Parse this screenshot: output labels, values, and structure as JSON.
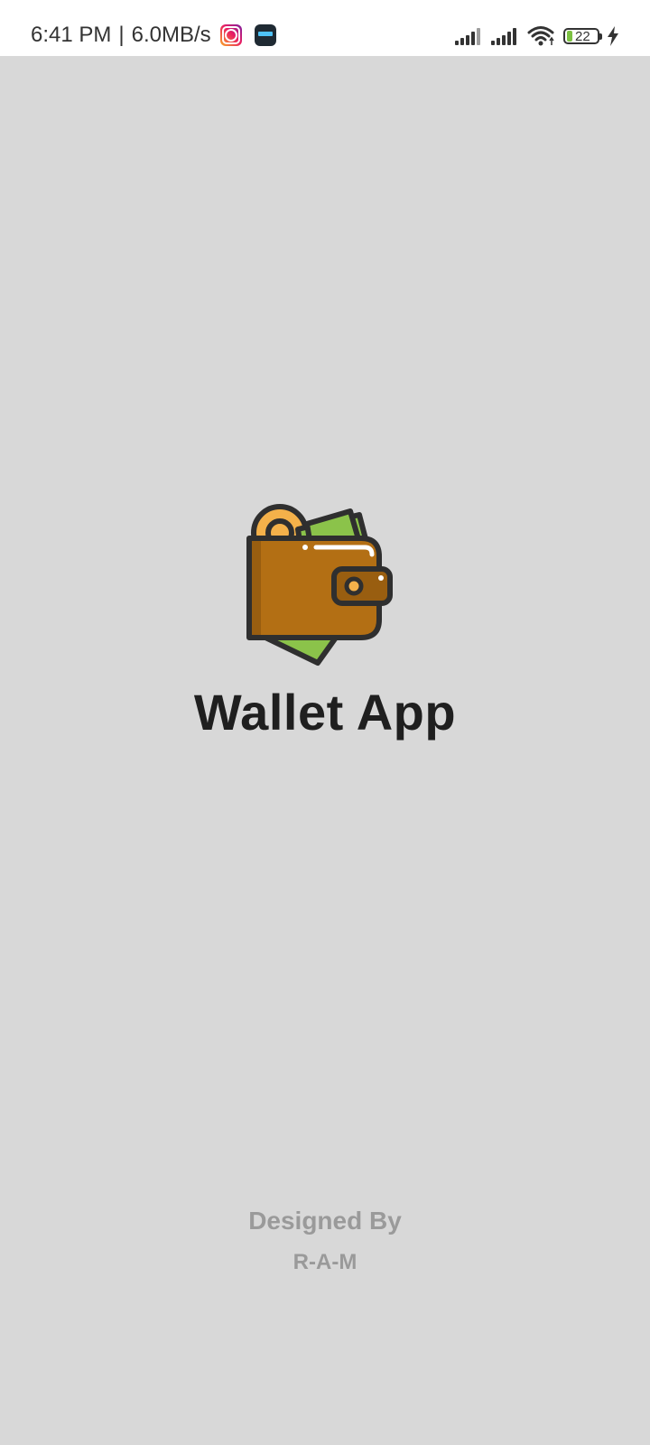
{
  "status_bar": {
    "time": "6:41 PM",
    "separator": "|",
    "speed": "6.0MB/s",
    "battery_level": "22",
    "icons": [
      "instagram-icon",
      "score-app-icon",
      "signal-bars-icon",
      "signal-bars-icon",
      "wifi-icon",
      "battery-icon",
      "charging-bolt-icon"
    ]
  },
  "splash": {
    "logo_icon": "wallet-icon",
    "title": "Wallet App",
    "credit_label": "Designed By",
    "credit_name": "R-A-M"
  },
  "colors": {
    "background": "#d8d8d8",
    "status_bar": "#ffffff",
    "title": "#1f1f1f",
    "credit": "#9a9a9a",
    "wallet_body": "#b36f14",
    "wallet_shadow": "#995e10",
    "cash": "#8bc34a",
    "coin": "#f4b14a",
    "outline": "#2f2f2f"
  }
}
